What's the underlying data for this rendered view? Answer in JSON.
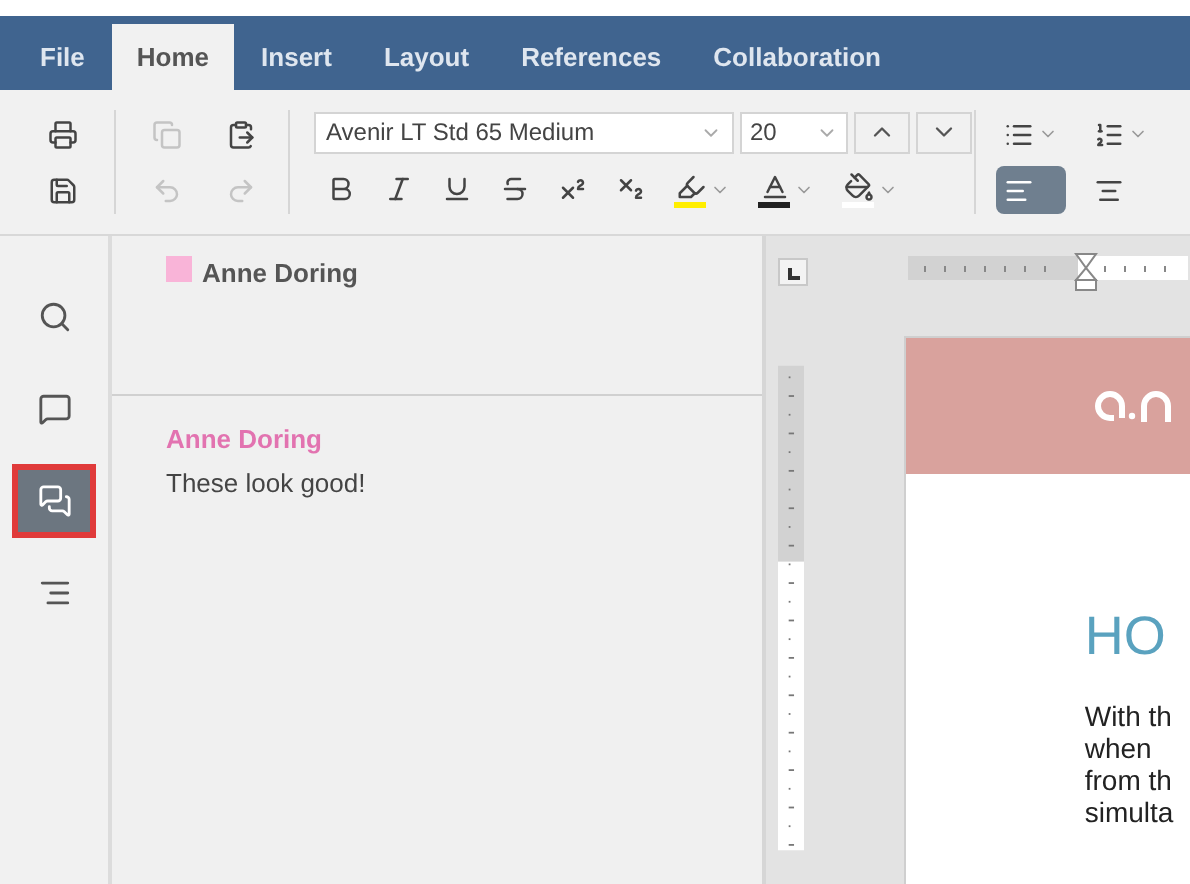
{
  "tabs": [
    {
      "label": "File",
      "selected": false
    },
    {
      "label": "Home",
      "selected": true
    },
    {
      "label": "Insert",
      "selected": false
    },
    {
      "label": "Layout",
      "selected": false
    },
    {
      "label": "References",
      "selected": false
    },
    {
      "label": "Collaboration",
      "selected": false
    }
  ],
  "toolbar": {
    "file_tools": [
      {
        "kind": "print",
        "disabled": false
      },
      {
        "kind": "save",
        "disabled": false
      }
    ],
    "edit_tools": [
      {
        "kind": "copy",
        "disabled": true
      },
      {
        "kind": "paste",
        "disabled": false
      },
      {
        "kind": "undo",
        "disabled": true
      },
      {
        "kind": "redo",
        "disabled": true
      }
    ],
    "font": {
      "value": "Avenir LT Std 65 Medium"
    },
    "size": {
      "value": "20"
    },
    "format_tools": [
      {
        "kind": "bold"
      },
      {
        "kind": "italic"
      },
      {
        "kind": "underline"
      },
      {
        "kind": "strikethrough"
      },
      {
        "kind": "superscript"
      },
      {
        "kind": "subscript"
      },
      {
        "kind": "highlight",
        "color": "#ffee00"
      },
      {
        "kind": "font_color",
        "color": "#222222"
      },
      {
        "kind": "shading",
        "color": "#ffffff"
      }
    ],
    "paragraph_tools": [
      {
        "kind": "bullets",
        "selected": false
      },
      {
        "kind": "numbering",
        "selected": false
      },
      {
        "kind": "align_left",
        "selected": true
      },
      {
        "kind": "align_center",
        "selected": false
      }
    ]
  },
  "sidebar": {
    "items": [
      {
        "kind": "search",
        "selected": false
      },
      {
        "kind": "comment",
        "selected": false
      },
      {
        "kind": "comments",
        "selected": true
      },
      {
        "kind": "navigation",
        "selected": false
      }
    ]
  },
  "comments_panel": {
    "filter": {
      "author": "Anne Doring",
      "color": "#f9b4d8"
    },
    "comments": [
      {
        "author": "Anne Doring",
        "color": "#e273b0",
        "text": "These look good!"
      }
    ]
  },
  "document": {
    "heading": "HO",
    "lines": [
      "With th",
      "when",
      "from th",
      "simulta"
    ]
  }
}
